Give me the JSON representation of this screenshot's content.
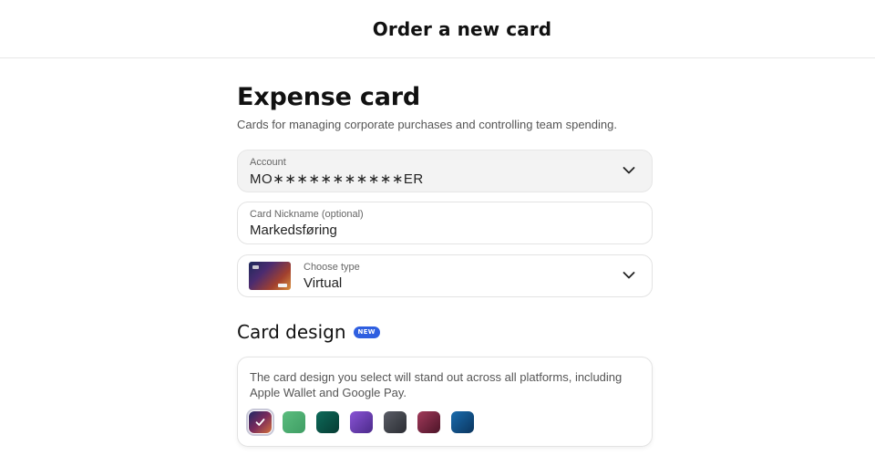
{
  "header": {
    "title": "Order a new card"
  },
  "page": {
    "title": "Expense card",
    "subtitle": "Cards for managing corporate purchases and controlling team spending."
  },
  "account": {
    "label": "Account",
    "value": "MO∗∗∗∗∗∗∗∗∗∗∗ER",
    "icon": "chevron-down-icon"
  },
  "nickname": {
    "label": "Card Nickname (optional)",
    "value": "Markedsføring"
  },
  "card_type": {
    "label": "Choose type",
    "value": "Virtual",
    "icon": "chevron-down-icon"
  },
  "design": {
    "title": "Card design",
    "badge": "NEW",
    "description": "The card design you select will stand out across all platforms, including Apple Wallet and Google Pay.",
    "swatches": [
      {
        "name": "sunset",
        "colors": [
          "#1f2a66",
          "#7a2a5c",
          "#d2703a"
        ],
        "selected": true
      },
      {
        "name": "green",
        "colors": [
          "#5bbd7e",
          "#3f9d64"
        ],
        "selected": false
      },
      {
        "name": "teal",
        "colors": [
          "#0e6b5a",
          "#063b33"
        ],
        "selected": false
      },
      {
        "name": "purple",
        "colors": [
          "#8a54d6",
          "#4b2a8a"
        ],
        "selected": false
      },
      {
        "name": "graphite",
        "colors": [
          "#5a5d66",
          "#2b2d33"
        ],
        "selected": false
      },
      {
        "name": "wine",
        "colors": [
          "#a23a5a",
          "#4c1428"
        ],
        "selected": false
      },
      {
        "name": "ocean",
        "colors": [
          "#1a6cae",
          "#0b355e"
        ],
        "selected": false
      }
    ]
  }
}
